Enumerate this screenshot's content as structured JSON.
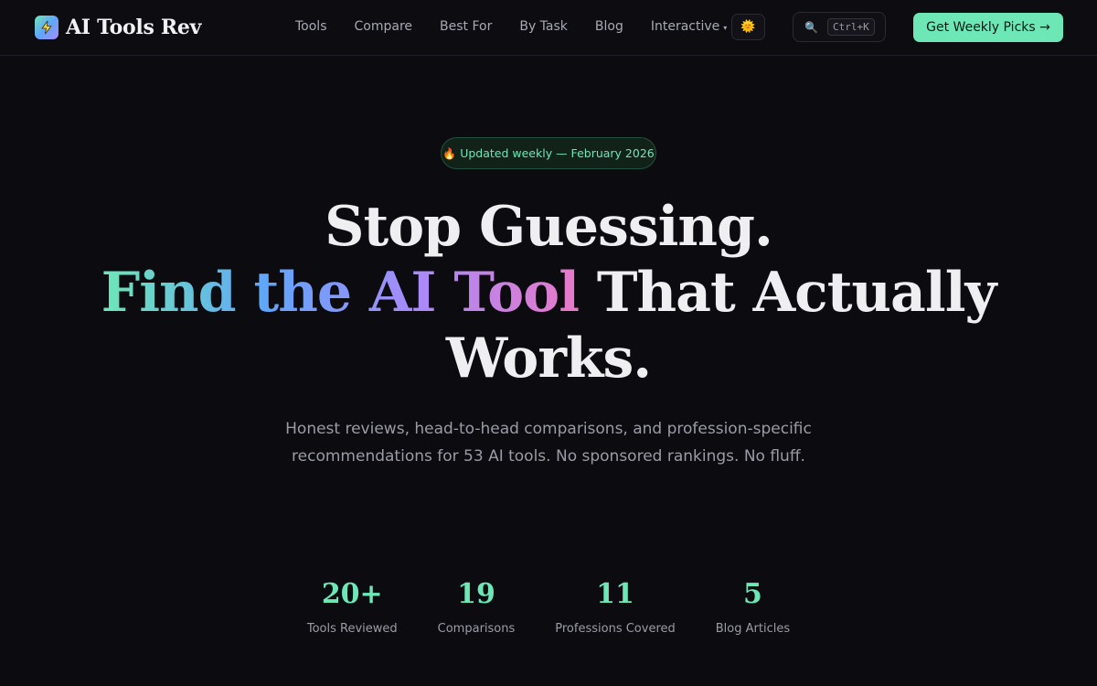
{
  "brand": {
    "name": "AI Tools Rev",
    "logo_icon": "lightning-bolt-icon"
  },
  "nav": {
    "items": [
      "Tools",
      "Compare",
      "Best For",
      "By Task",
      "Blog",
      "Interactive"
    ],
    "interactive_caret": "▾"
  },
  "theme_toggle": {
    "icon": "sun-icon",
    "glyph": "🌞"
  },
  "search": {
    "icon": "magnifier-icon",
    "glyph": "🔍",
    "shortcut": "Ctrl+K"
  },
  "cta": {
    "label": "Get Weekly Picks →"
  },
  "badge": {
    "icon": "fire-icon",
    "glyph": "🔥",
    "text": "Updated weekly — February 2026"
  },
  "hero": {
    "line1": "Stop Guessing.",
    "line2_gradient": "Find the AI Tool",
    "line2_rest": " That Actually",
    "line3": "Works.",
    "subtitle": "Honest reviews, head-to-head comparisons, and profession-specific recommendations for 53 AI tools. No sponsored rankings. No fluff."
  },
  "stats": [
    {
      "value": "20+",
      "label": "Tools Reviewed"
    },
    {
      "value": "19",
      "label": "Comparisons"
    },
    {
      "value": "11",
      "label": "Professions Covered"
    },
    {
      "value": "5",
      "label": "Blog Articles"
    }
  ],
  "colors": {
    "accent": "#6ee7b7",
    "background": "#0c0c10",
    "text": "#efeff2",
    "muted": "#9a9ba6"
  }
}
